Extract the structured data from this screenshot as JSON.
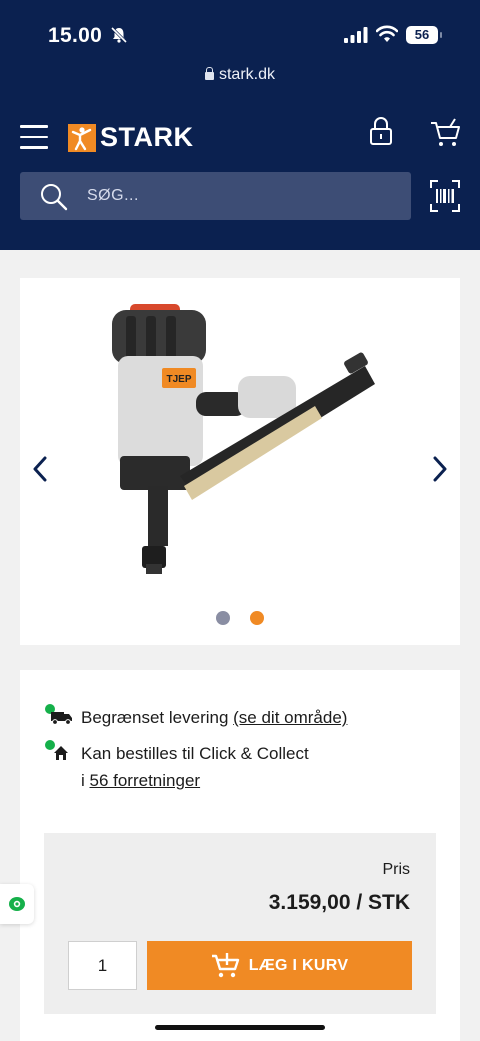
{
  "status_bar": {
    "time": "15.00",
    "battery": "56"
  },
  "browser": {
    "url": "stark.dk"
  },
  "header": {
    "brand": "STARK",
    "search_placeholder": "SØG..."
  },
  "product_image": {
    "badge": "TJEP",
    "current_slide": 2,
    "slide_count": 2
  },
  "availability": {
    "delivery_text": "Begrænset levering ",
    "delivery_link": "(se dit område)",
    "collect_text": "Kan bestilles til Click & Collect",
    "stores_prefix": "i ",
    "stores_link": "56 forretninger"
  },
  "purchase": {
    "price_label": "Pris",
    "price": "3.159,00 / STK",
    "quantity": "1",
    "add_to_cart": "LÆG I KURV"
  },
  "colors": {
    "navy": "#0b2150",
    "orange": "#f08a24",
    "green": "#15b04a"
  }
}
